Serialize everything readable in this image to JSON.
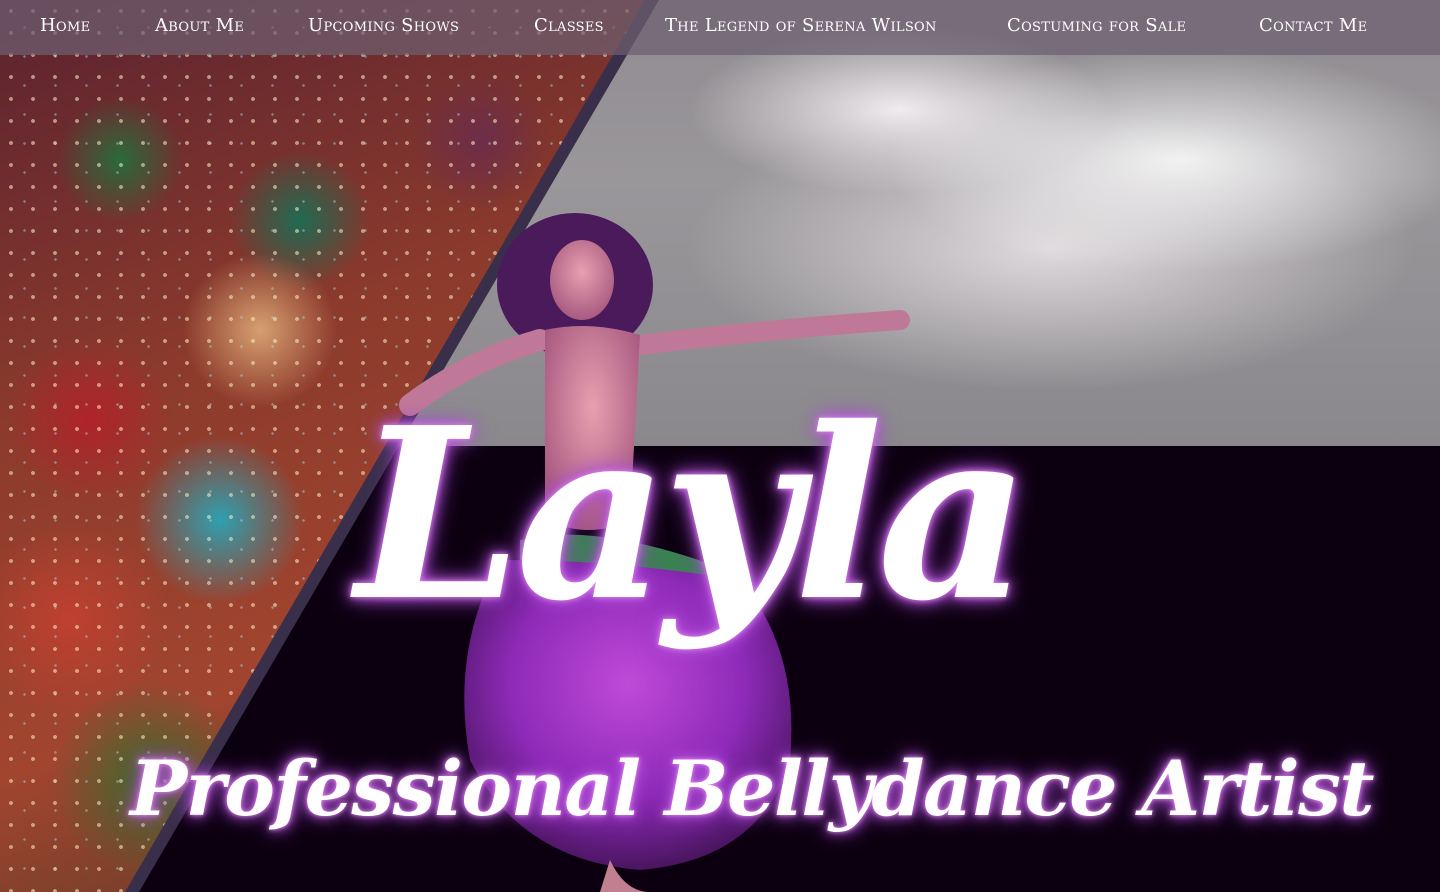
{
  "nav": {
    "items": [
      {
        "label": "Home"
      },
      {
        "label": "About Me"
      },
      {
        "label": "Upcoming Shows"
      },
      {
        "label": "Classes"
      },
      {
        "label": "The Legend of Serena Wilson"
      },
      {
        "label": "Costuming for Sale"
      },
      {
        "label": "Contact Me"
      }
    ]
  },
  "hero": {
    "title": "Layla",
    "subtitle": "Professional Bellydance Artist"
  },
  "colors": {
    "nav_background": "#6e6070",
    "text": "#ffffff",
    "glow": "#c060e0",
    "dark_background": "#0c0010",
    "dress": "#9b2fc0"
  }
}
